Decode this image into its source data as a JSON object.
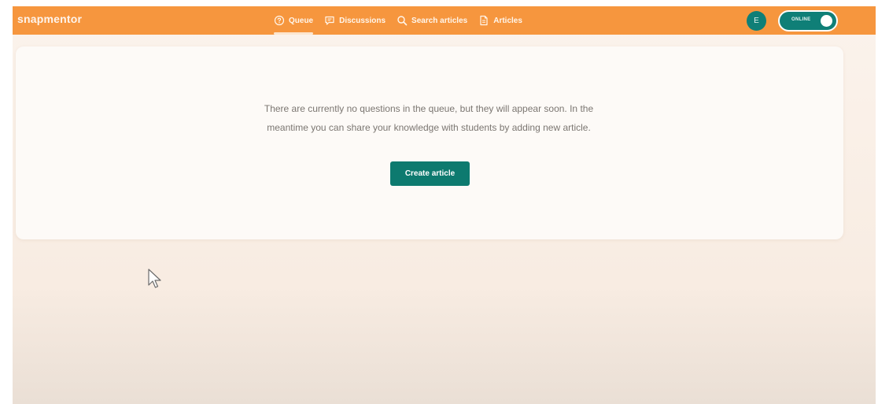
{
  "app": {
    "logo_text": "snapmentor"
  },
  "nav": {
    "items": [
      {
        "label": "Queue",
        "icon": "question-circle-icon",
        "active": true
      },
      {
        "label": "Discussions",
        "icon": "chat-bubble-icon",
        "active": false
      },
      {
        "label": "Search articles",
        "icon": "search-icon",
        "active": false
      },
      {
        "label": "Articles",
        "icon": "document-icon",
        "active": false
      }
    ]
  },
  "user": {
    "avatar_initial": "E",
    "status_label": "ONLINE"
  },
  "main": {
    "empty_message": "There are currently no questions in the queue, but they will appear soon. In the meantime you can share your knowledge with students by adding new article.",
    "create_button_label": "Create article"
  },
  "colors": {
    "topbar": "#f6963e",
    "accent_teal": "#0d7a6f",
    "background": "#fbf3ec",
    "card": "#fdfaf7",
    "text_muted": "#7b7671"
  }
}
